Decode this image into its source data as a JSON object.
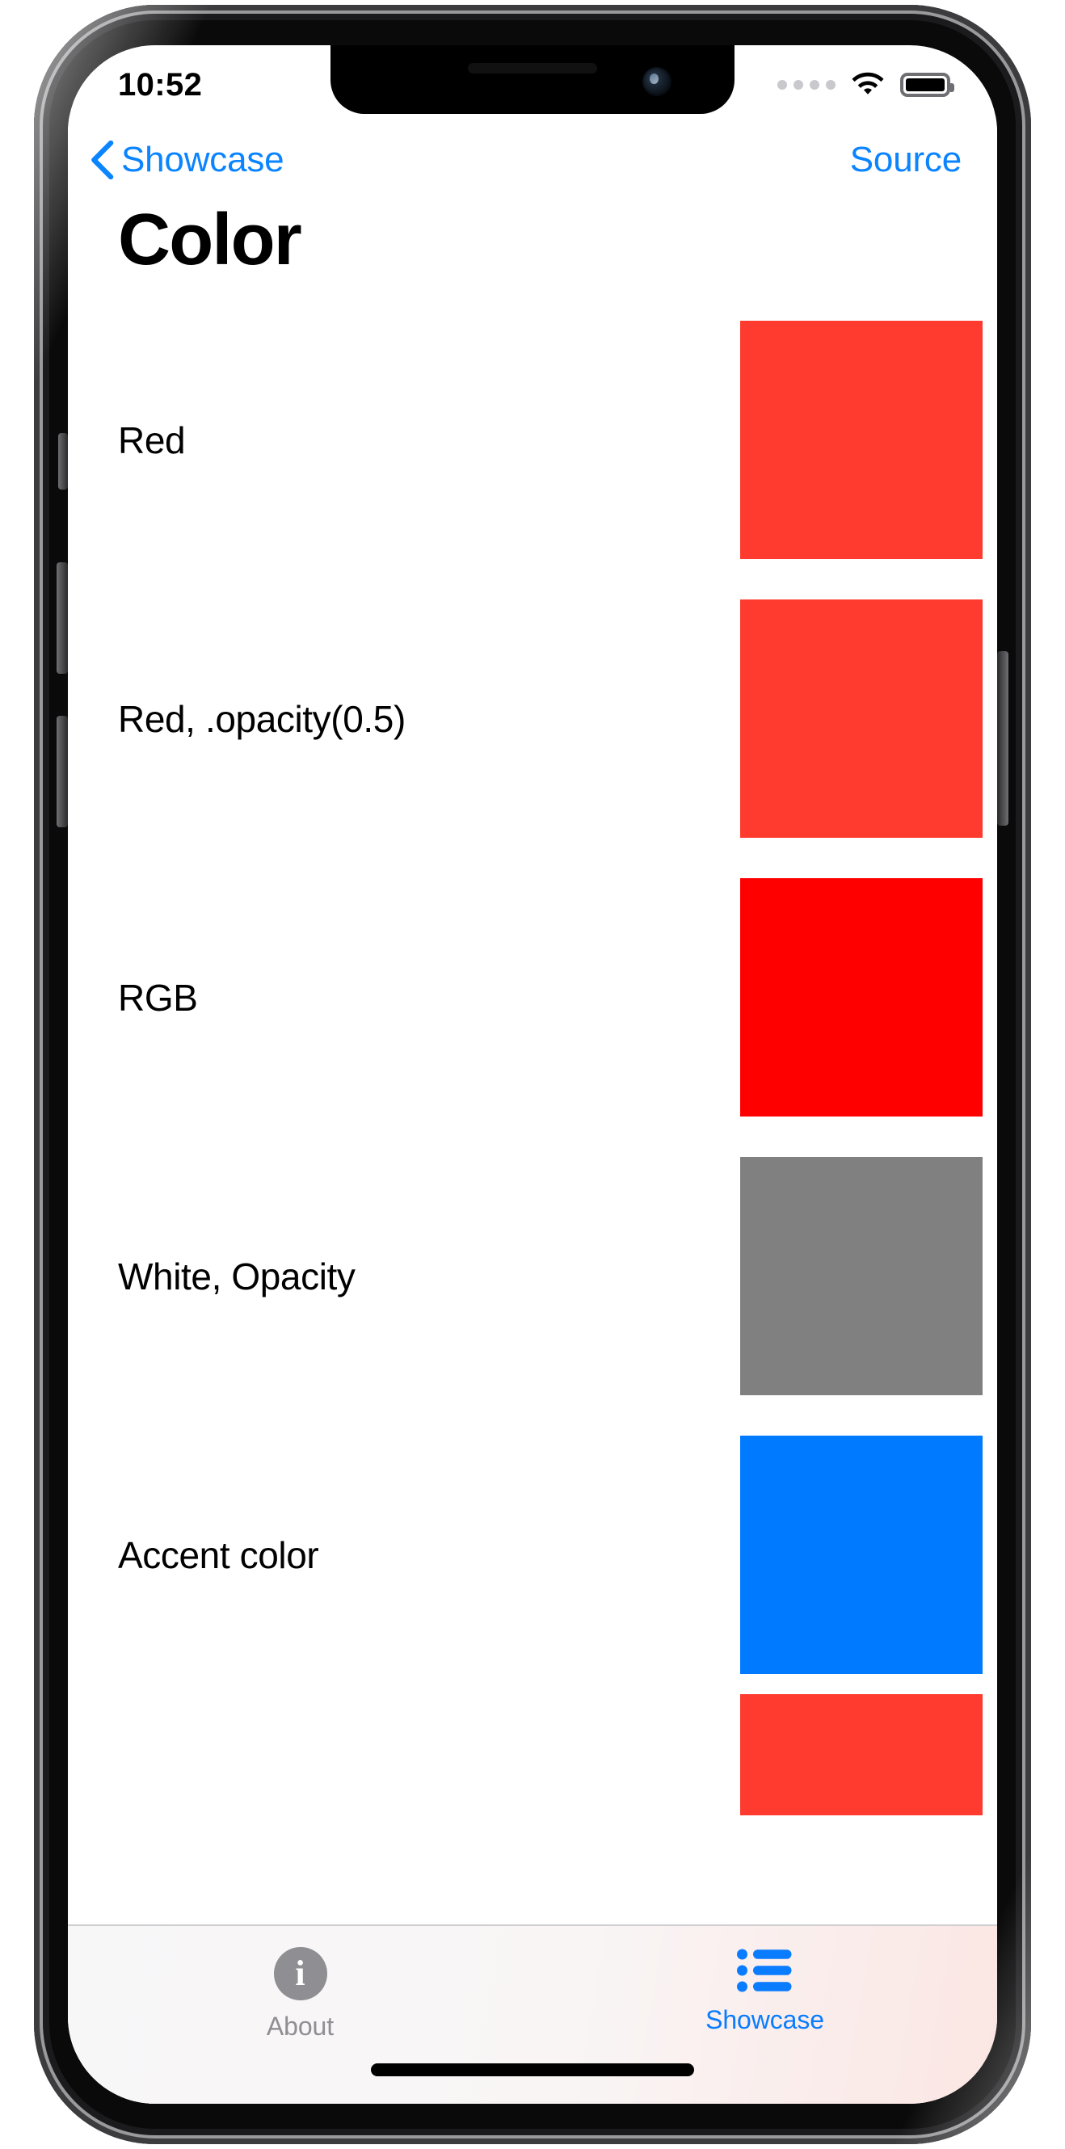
{
  "status_bar": {
    "time": "10:52",
    "cellular_icon": "cellular-dots-icon",
    "wifi_icon": "wifi-icon",
    "battery_icon": "battery-full-icon",
    "dot_color": "#c9c9cd"
  },
  "nav_bar": {
    "back_icon": "chevron-left-icon",
    "back_label": "Showcase",
    "action_label": "Source",
    "tint_color": "#0a84ff"
  },
  "page_title": "Color",
  "list": {
    "rows": [
      {
        "label": "Red",
        "color": "#ff3b2f",
        "swatch_name": "swatch-red"
      },
      {
        "label": "Red, .opacity(0.5)",
        "color": "#ff3b2f",
        "swatch_name": "swatch-red-opacity"
      },
      {
        "label": "RGB",
        "color": "#ff0000",
        "swatch_name": "swatch-rgb"
      },
      {
        "label": "White, Opacity",
        "color": "#808080",
        "swatch_name": "swatch-white-opacity"
      },
      {
        "label": "Accent color",
        "color": "#007aff",
        "swatch_name": "swatch-accent"
      },
      {
        "label": "",
        "color": "#ff3b2f",
        "swatch_name": "swatch-partial"
      }
    ]
  },
  "tab_bar": {
    "tabs": [
      {
        "label": "About",
        "icon": "info-circle-icon",
        "active": false,
        "color": "#8e8e93"
      },
      {
        "label": "Showcase",
        "icon": "list-bullet-icon",
        "active": true,
        "color": "#0a7cff"
      }
    ]
  }
}
